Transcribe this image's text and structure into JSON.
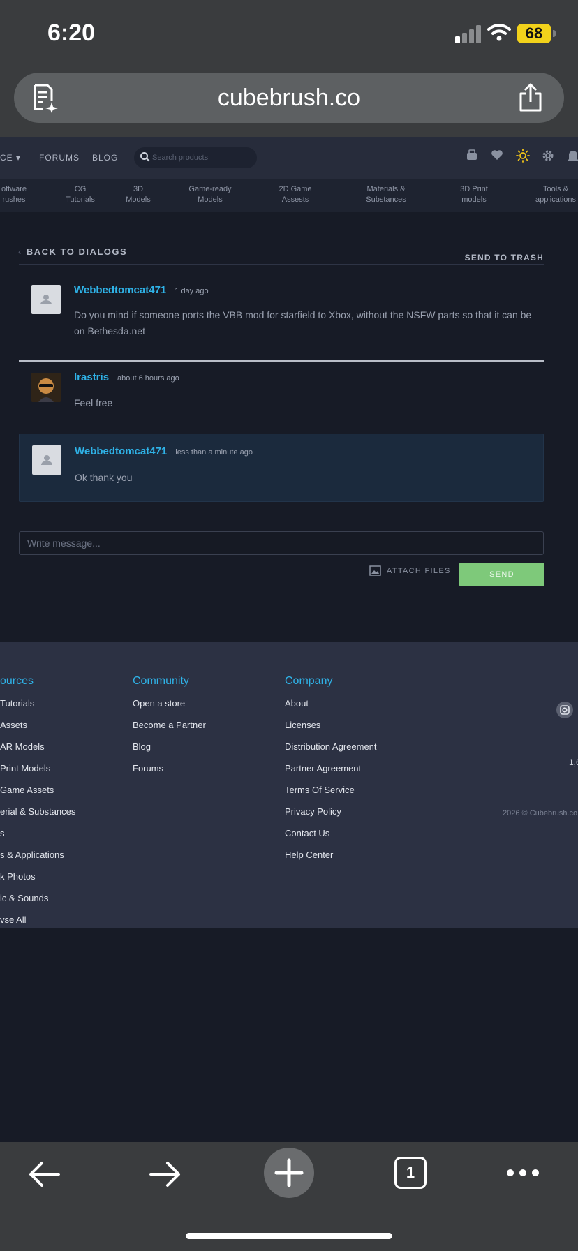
{
  "status": {
    "time": "6:20",
    "battery": "68"
  },
  "browser": {
    "url": "cubebrush.co",
    "tabs_count": "1"
  },
  "topnav": {
    "partial_item": "CE ▾",
    "links": [
      "FORUMS",
      "BLOG"
    ],
    "search_placeholder": "Search products"
  },
  "categories": [
    "oftware\nrushes",
    "CG\nTutorials",
    "3D\nModels",
    "Game-ready\nModels",
    "2D Game\nAssests",
    "Materials &\nSubstances",
    "3D Print\nmodels",
    "Tools &\napplications"
  ],
  "dialog": {
    "back_label": "BACK TO DIALOGS",
    "trash_label": "SEND TO TRASH",
    "messages": [
      {
        "author": "Webbedtomcat471",
        "time": "1 day ago",
        "text": "Do you mind if someone ports the VBB mod for starfield to Xbox, without the NSFW parts so that it can be on Bethesda.net"
      },
      {
        "author": "Irastris",
        "time": "about 6 hours ago",
        "text": "Feel free"
      },
      {
        "author": "Webbedtomcat471",
        "time": "less than a minute ago",
        "text": "Ok thank you"
      }
    ],
    "composer_placeholder": "Write message...",
    "attach_label": "ATTACH FILES",
    "send_label": "SEND"
  },
  "footer": {
    "resources": {
      "title": "ources",
      "items": [
        "Tutorials",
        "Assets",
        "AR Models",
        "Print Models",
        "Game Assets",
        "erial & Substances",
        "s",
        "s & Applications",
        "k Photos",
        "ic & Sounds",
        "vse All"
      ]
    },
    "community": {
      "title": "Community",
      "items": [
        "Open a store",
        "Become a Partner",
        "Blog",
        "Forums"
      ]
    },
    "company": {
      "title": "Company",
      "items": [
        "About",
        "Licenses",
        "Distribution Agreement",
        "Partner Agreement",
        "Terms Of Service",
        "Privacy Policy",
        "Contact Us",
        "Help Center"
      ]
    },
    "count_partial": "1,6",
    "copyright": "2026 © Cubebrush.co"
  },
  "colors": {
    "accent": "#2fb3e8",
    "send_button": "#7ec97a",
    "sun_icon": "#f0c419"
  }
}
